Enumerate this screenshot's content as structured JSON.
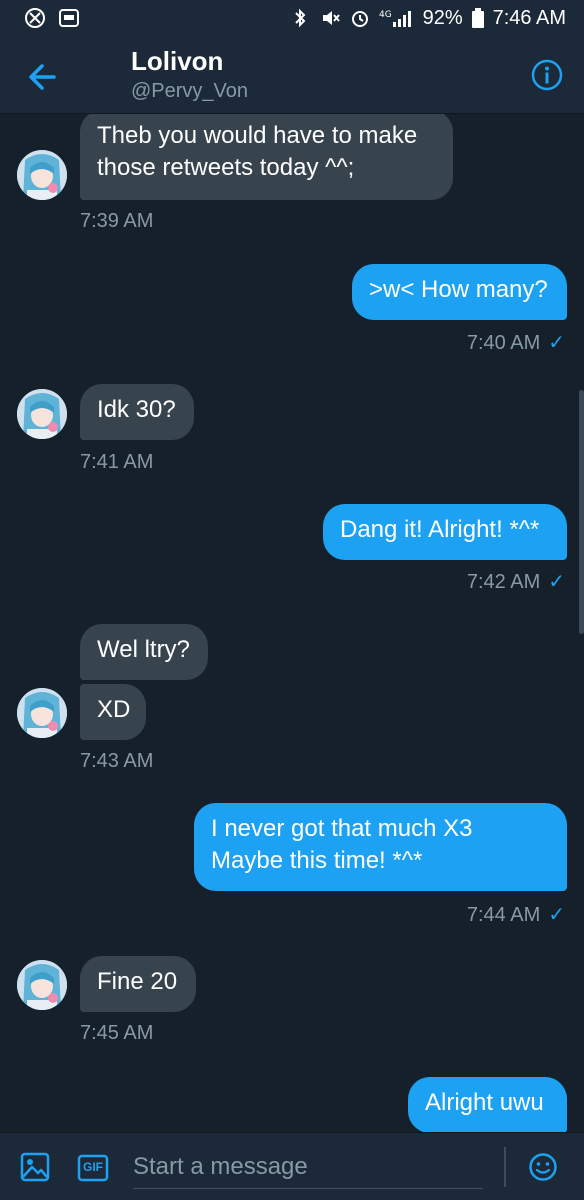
{
  "status_bar": {
    "battery": "92%",
    "time": "7:46 AM",
    "signal_text": "4G"
  },
  "header": {
    "name": "Lolivon",
    "handle": "@Pervy_Von"
  },
  "messages": [
    {
      "text_lines": [
        "Theb you would have to make",
        "those retweets today ^^;"
      ],
      "time": "7:39 AM"
    },
    {
      "text_lines": [
        ">w< How many?"
      ],
      "time": "7:40 AM"
    },
    {
      "text_lines": [
        "Idk 30?"
      ],
      "time": "7:41 AM"
    },
    {
      "text_lines": [
        "Dang it! Alright! *^*"
      ],
      "time": "7:42 AM"
    },
    {
      "text_lines": [
        "Wel ltry?"
      ]
    },
    {
      "text_lines": [
        "XD"
      ],
      "time": "7:43 AM"
    },
    {
      "text_lines": [
        "I never got that much X3",
        "Maybe this time! *^*"
      ],
      "time": "7:44 AM"
    },
    {
      "text_lines": [
        "Fine 20"
      ],
      "time": "7:45 AM"
    },
    {
      "text_lines": [
        "Alright uwu"
      ]
    }
  ],
  "composer": {
    "placeholder": "Start a message",
    "gif_label": "GIF"
  },
  "colors": {
    "accent": "#1da1f2",
    "background": "#15202b",
    "bar": "#1c2938",
    "incoming_bubble": "#38444d",
    "muted_text": "#8899a6"
  },
  "icons": {
    "back": "arrow-left-icon",
    "info": "info-icon",
    "image": "image-icon",
    "gif": "gif-icon",
    "emoji": "emoji-icon",
    "read_check": "checkmark-icon"
  }
}
